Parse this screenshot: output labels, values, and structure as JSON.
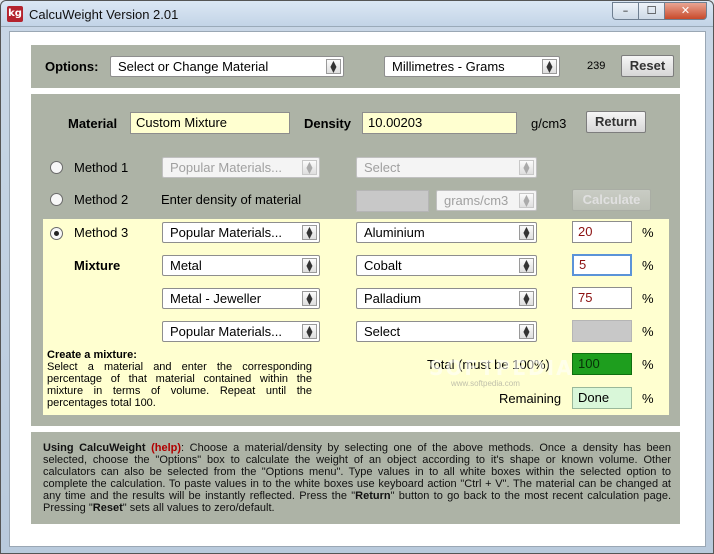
{
  "window": {
    "title": "CalcuWeight Version 2.01",
    "icon_text": "kg",
    "minimize_glyph": "–",
    "maximize_glyph": "☐",
    "close_glyph": "✕"
  },
  "options": {
    "label": "Options:",
    "material_select": "Select or Change Material",
    "units_select": "Millimetres - Grams",
    "count": "239",
    "reset_label": "Reset"
  },
  "material": {
    "material_label": "Material",
    "material_value": "Custom Mixture",
    "density_label": "Density",
    "density_value": "10.00203",
    "density_unit": "g/cm3",
    "return_label": "Return"
  },
  "method1": {
    "label": "Method 1",
    "popular_select": "Popular Materials...",
    "select_value": "Select"
  },
  "method2": {
    "label": "Method 2",
    "description": "Enter density of material",
    "density_input": "",
    "unit_select": "grams/cm3",
    "calculate_label": "Calculate"
  },
  "method3": {
    "label": "Method 3",
    "mixture_label": "Mixture",
    "rows": [
      {
        "category": "Popular Materials...",
        "material": "Aluminium",
        "percent": "20",
        "percent_sign": "%"
      },
      {
        "category": "Metal",
        "material": "Cobalt",
        "percent": "5",
        "percent_sign": "%"
      },
      {
        "category": "Metal - Jeweller",
        "material": "Palladium",
        "percent": "75",
        "percent_sign": "%"
      },
      {
        "category": "Popular Materials...",
        "material": "Select",
        "percent": "",
        "percent_sign": "%"
      }
    ],
    "total_label": "Total (must be 100%)",
    "total_value": "100",
    "total_percent_sign": "%",
    "remaining_label": "Remaining",
    "remaining_value": "Done",
    "remaining_percent_sign": "%"
  },
  "create_mixture": {
    "heading": "Create a mixture:",
    "text": "Select a material and enter the corresponding percentage of that material contained within the mixture in terms of volume. Repeat until the percentages total 100."
  },
  "help": {
    "lead": "Using CalcuWeight",
    "link": "(help)",
    "text_1": ": Choose a material/density by selecting one of the above methods. Once a density has been selected, choose the \"Options\" box to calculate the weight of an object according to it's shape or known volume. Other calculators can also be selected from the \"Options menu\". Type values in to all white boxes within the selected option to complete the calculation. To paste values in to the white boxes use keyboard action \"Ctrl + V\". The material can be changed at any time and the results will be instantly reflected. Press the \"",
    "return_word": "Return",
    "text_2": "\" button to go back to the most recent calculation page. Pressing \"",
    "reset_word": "Reset",
    "text_3": "\" sets all values to zero/default."
  },
  "watermark": {
    "text": "SOFTPEDIA",
    "url": "www.softpedia.com"
  },
  "colors": {
    "panel": "#adb3a6",
    "input_yellow": "#ffffd0",
    "mixture_band": "#ffffd0",
    "total_green": "#1e9e1e",
    "remaining_bg": "#d9f7d9",
    "disabled_gray": "#c8c8c8",
    "help_link": "#b00000"
  }
}
